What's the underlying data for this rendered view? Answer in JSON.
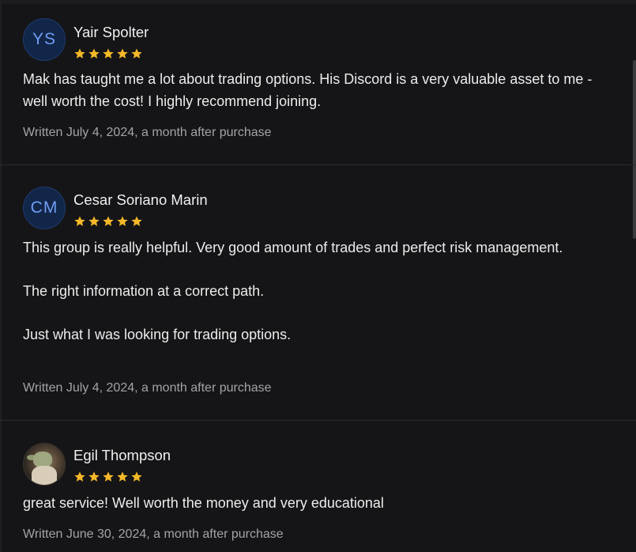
{
  "reviews": [
    {
      "avatar_initials": "YS",
      "name": "Yair Spolter",
      "rating": 5,
      "paragraphs": [
        "Mak has taught me a lot about trading options. His Discord is a very valuable asset to me - well worth the cost! I highly recommend joining."
      ],
      "meta": "Written July 4, 2024, a month after purchase"
    },
    {
      "avatar_initials": "CM",
      "name": "Cesar Soriano Marin",
      "rating": 5,
      "paragraphs": [
        "This group is really helpful. Very good amount of trades and perfect risk management.",
        "The right information at a correct path.",
        "Just what I was looking for trading options."
      ],
      "meta": "Written July 4, 2024, a month after purchase"
    },
    {
      "avatar_initials": "",
      "name": "Egil Thompson",
      "rating": 5,
      "paragraphs": [
        "great service! Well worth the money and very educational"
      ],
      "meta": "Written June 30, 2024, a month after purchase"
    }
  ],
  "colors": {
    "star": "#f5b829",
    "avatar_bg": "#12264a",
    "avatar_text": "#6f9df2",
    "divider": "#2c2c30"
  },
  "icons": {
    "star": "star-icon"
  }
}
